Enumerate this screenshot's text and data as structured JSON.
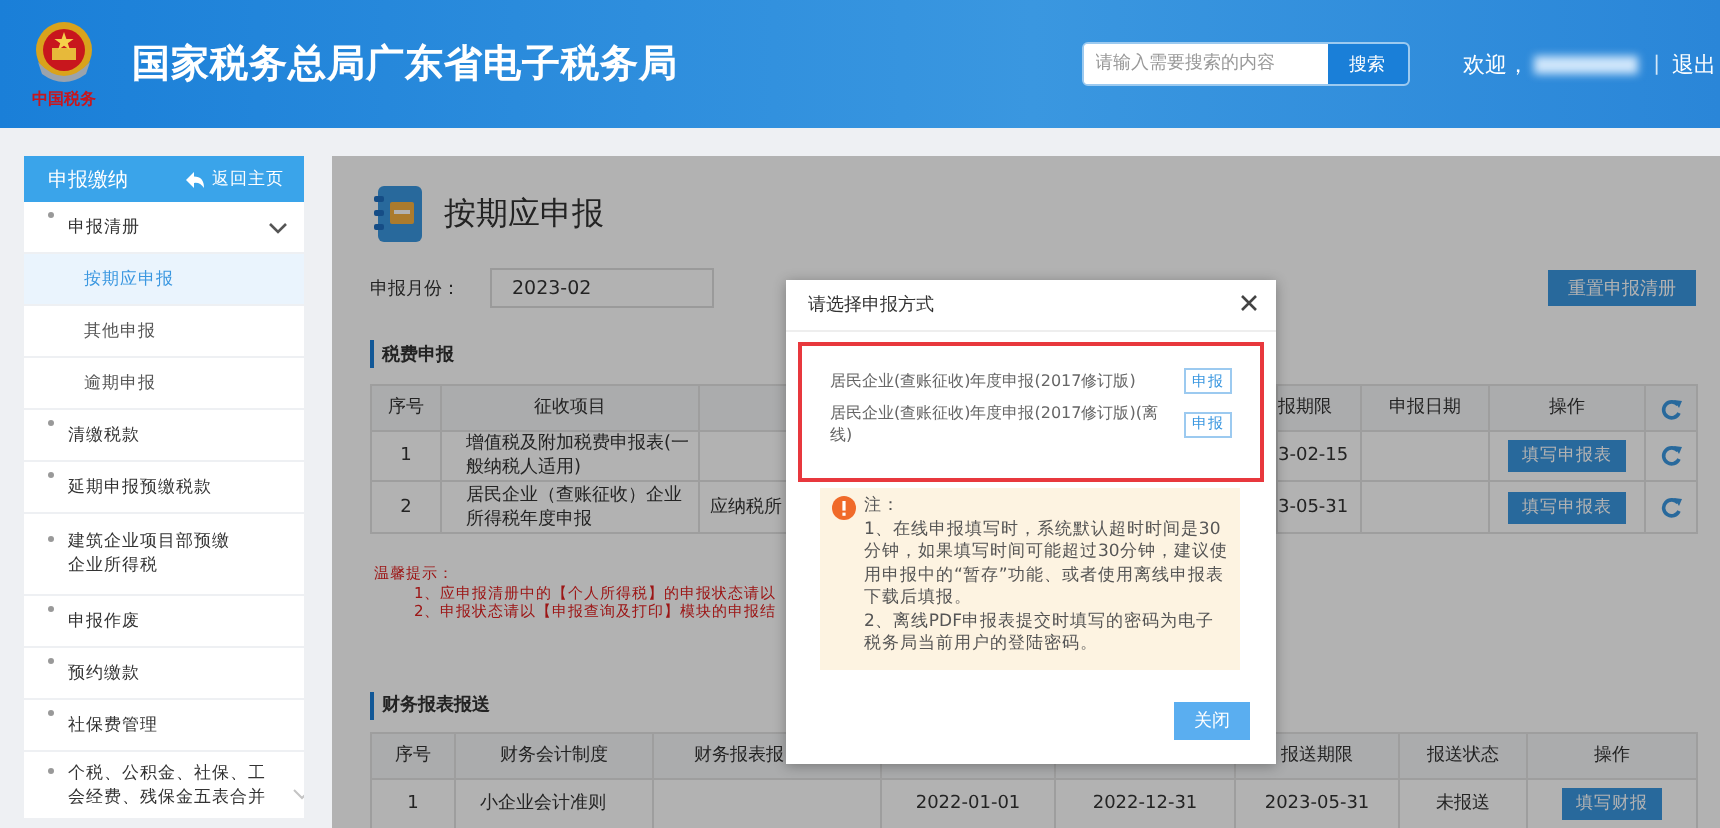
{
  "header": {
    "logo_text": "中国税务",
    "title": "国家税务总局广东省电子税务局",
    "search": {
      "placeholder": "请输入需要搜索的内容",
      "button": "搜索"
    },
    "welcome": "欢迎，",
    "separator": "|",
    "logout": "退出"
  },
  "sidebar": {
    "title": "申报缴纳",
    "back": "返回主页",
    "items": [
      {
        "label": "申报清册",
        "kind": "group",
        "expanded": true,
        "selected": false,
        "children": [
          {
            "label": "按期应申报",
            "selected": true
          },
          {
            "label": "其他申报",
            "selected": false
          },
          {
            "label": "逾期申报",
            "selected": false
          }
        ]
      },
      {
        "label": "清缴税款",
        "kind": "link",
        "selected": false
      },
      {
        "label": "延期申报预缴税款",
        "kind": "link",
        "selected": false
      },
      {
        "label": "建筑企业项目部预缴企业所得税",
        "kind": "link",
        "selected": false
      },
      {
        "label": "申报作废",
        "kind": "link",
        "selected": false
      },
      {
        "label": "预约缴款",
        "kind": "link",
        "selected": false
      },
      {
        "label": "社保费管理",
        "kind": "link",
        "selected": false
      },
      {
        "label": "个税、公积金、社保、工会经费、残保金五表合并",
        "kind": "group",
        "expanded": false,
        "selected": false
      }
    ]
  },
  "main": {
    "title": "按期应申报",
    "month_label": "申报月份：",
    "month_value": "2023-02",
    "reset_button": "重置申报清册",
    "tax_section": {
      "title": "税费申报",
      "columns": {
        "number": "序号",
        "item": "征收项目",
        "deadline": "报期限",
        "date": "申报日期",
        "action": "操作"
      },
      "rows": [
        {
          "number": "1",
          "item": "增值税及附加税费申报表(一般纳税人适用)",
          "deadline": "3-02-15",
          "action": "填写申报表"
        },
        {
          "number": "2",
          "item": "居民企业（查账征收）企业所得税年度申报",
          "column_3": "应纳税所",
          "deadline": "3-05-31",
          "action": "填写申报表"
        }
      ]
    },
    "tips": {
      "title": "温馨提示：",
      "lines": [
        "1、应申报清册中的【个人所得税】的申报状态请以",
        "2、申报状态请以【申报查询及打印】模块的申报结"
      ]
    },
    "finance_section": {
      "title": "财务报表报送",
      "columns": {
        "number": "序号",
        "system": "财务会计制度",
        "column_3": "财务报表报",
        "deadline": "报送期限",
        "status": "报送状态",
        "action": "操作"
      },
      "rows": [
        {
          "number": "1",
          "system": "小企业会计准则",
          "start": "2022-01-01",
          "end": "2022-12-31",
          "deadline": "2023-05-31",
          "status": "未报送",
          "action": "填写财报"
        }
      ]
    }
  },
  "modal": {
    "title": "请选择申报方式",
    "options": [
      {
        "label": "居民企业(查账征收)年度申报(2017修订版)",
        "button": "申报"
      },
      {
        "label": "居民企业(查账征收)年度申报(2017修订版)(离线)",
        "button": "申报"
      }
    ],
    "note": {
      "title": "注：",
      "paragraphs": [
        "1、在线申报填写时，系统默认超时时间是30分钟，如果填写时间可能超过30分钟，建议使用申报中的“暂存”功能、或者使用离线申报表下载后填报。",
        "2、离线PDF申报表提交时填写的密码为电子税务局当前用户的登陆密码。"
      ]
    },
    "close_button": "关闭"
  }
}
